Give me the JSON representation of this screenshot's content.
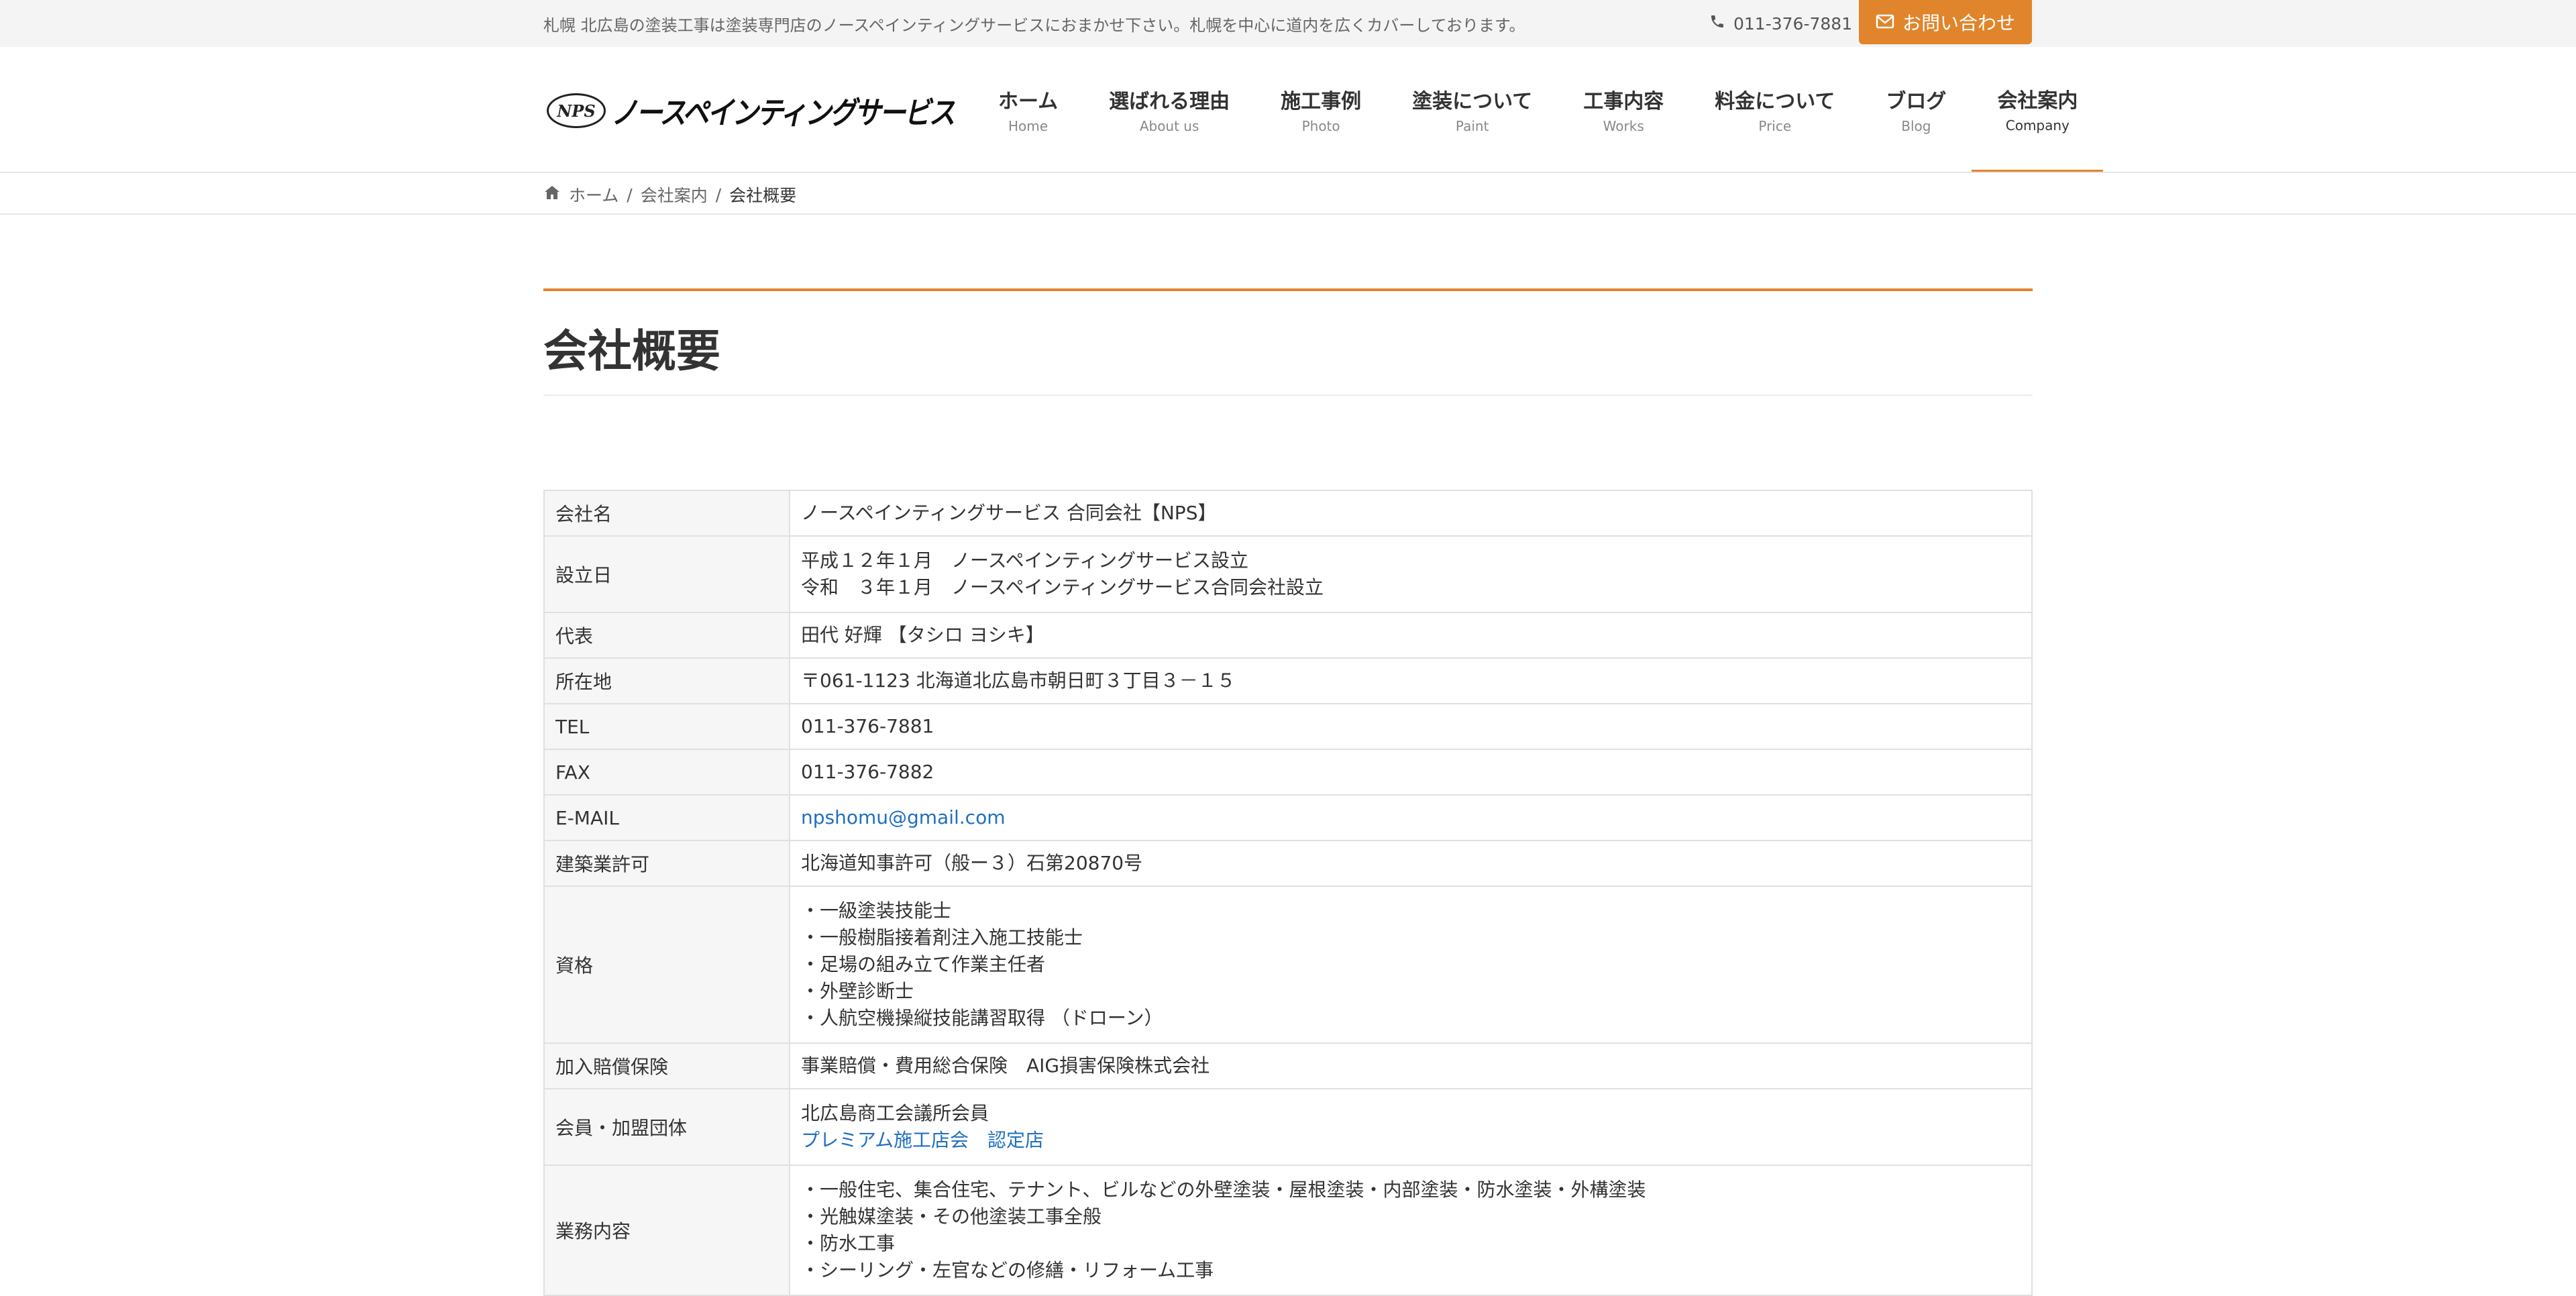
{
  "topbar": {
    "tagline": "札幌 北広島の塗装工事は塗装専門店のノースペインティングサービスにおまかせ下さい。札幌を中心に道内を広くカバーしております。",
    "phone": "011-376-7881",
    "contact_button": "お問い合わせ"
  },
  "logo": {
    "mark": "NPS",
    "text": "ノースペインティングサービス"
  },
  "nav": [
    {
      "jp": "ホーム",
      "en": "Home"
    },
    {
      "jp": "選ばれる理由",
      "en": "About us"
    },
    {
      "jp": "施工事例",
      "en": "Photo"
    },
    {
      "jp": "塗装について",
      "en": "Paint"
    },
    {
      "jp": "工事内容",
      "en": "Works"
    },
    {
      "jp": "料金について",
      "en": "Price"
    },
    {
      "jp": "ブログ",
      "en": "Blog"
    },
    {
      "jp": "会社案内",
      "en": "Company"
    }
  ],
  "breadcrumb": {
    "home": "ホーム",
    "parent": "会社案内",
    "current": "会社概要",
    "separator": "/"
  },
  "page": {
    "title": "会社概要"
  },
  "company": {
    "name_label": "会社名",
    "name": "ノースペインティングサービス 合同会社【NPS】",
    "founded_label": "設立日",
    "founded_1": "平成１２年１月　ノースペインティングサービス設立",
    "founded_2": "令和　３年１月　ノースペインティングサービス合同会社設立",
    "rep_label": "代表",
    "rep": "田代 好輝 【タシロ ヨシキ】",
    "address_label": "所在地",
    "address": "〒061-1123 北海道北広島市朝日町３丁目３－１５",
    "tel_label": "TEL",
    "tel": "011-376-7881",
    "fax_label": "FAX",
    "fax": "011-376-7882",
    "email_label": "E-MAIL",
    "email": "npshomu@gmail.com",
    "license_label": "建築業許可",
    "license": "北海道知事許可（般ー３）石第20870号",
    "quals_label": "資格",
    "qual_1": "・一級塗装技能士",
    "qual_2": "・一般樹脂接着剤注入施工技能士",
    "qual_3": "・足場の組み立て作業主任者",
    "qual_4": "・外壁診断士",
    "qual_5": "・人航空機操縦技能講習取得 （ドローン）",
    "insurance_label": "加入賠償保険",
    "insurance": "事業賠償・費用総合保険　AIG損害保険株式会社",
    "member_label": "会員・加盟団体",
    "member_1": "北広島商工会議所会員",
    "member_2": "プレミアム施工店会　認定店",
    "business_label": "業務内容",
    "business_1": "・一般住宅、集合住宅、テナント、ビルなどの外壁塗装・屋根塗装・内部塗装・防水塗装・外構塗装",
    "business_2": "・光触媒塗装・その他塗装工事全般",
    "business_3": "・防水工事",
    "business_4": "・シーリング・左官などの修繕・リフォーム工事"
  },
  "colors": {
    "accent": "#e0852b",
    "link": "#1f6fbf",
    "topbar_bg": "#f4f4f4",
    "table_header_bg": "#f6f6f6"
  }
}
